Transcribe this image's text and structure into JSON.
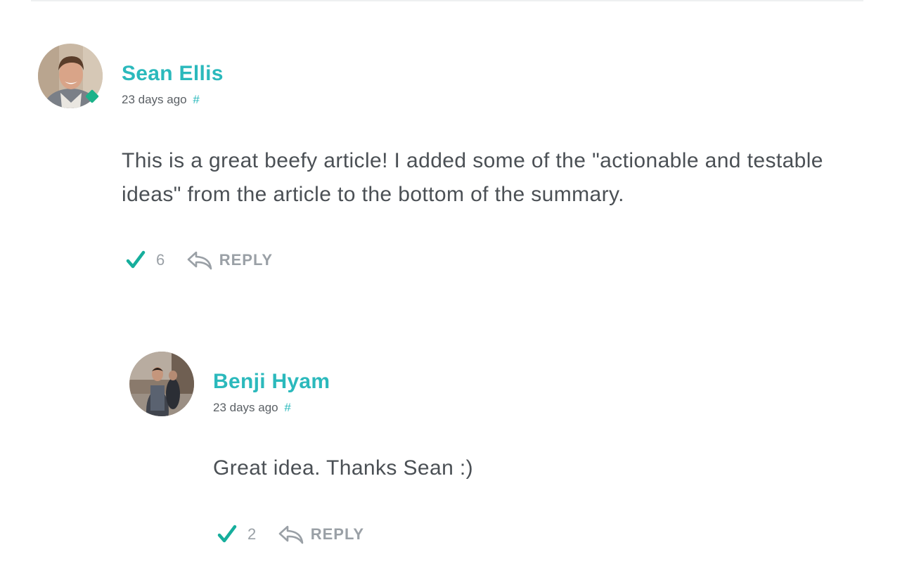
{
  "theme": {
    "accent": "#2bb9bc",
    "upvote_color": "#16ae9c",
    "muted_text": "#9aa0a6",
    "body_text": "#4b5055"
  },
  "comments": [
    {
      "author": "Sean Ellis",
      "timestamp": "23 days ago",
      "permalink": "#",
      "body": "This is a great beefy article! I added some of the \"actionable and testable ideas\" from the article to the bottom of the summary.",
      "votes": "6",
      "reply_label": "REPLY",
      "avatar_icon": "avatar-photo"
    },
    {
      "author": "Benji Hyam",
      "timestamp": "23 days ago",
      "permalink": "#",
      "body": "Great idea. Thanks Sean :)",
      "votes": "2",
      "reply_label": "REPLY",
      "avatar_icon": "avatar-photo"
    }
  ]
}
